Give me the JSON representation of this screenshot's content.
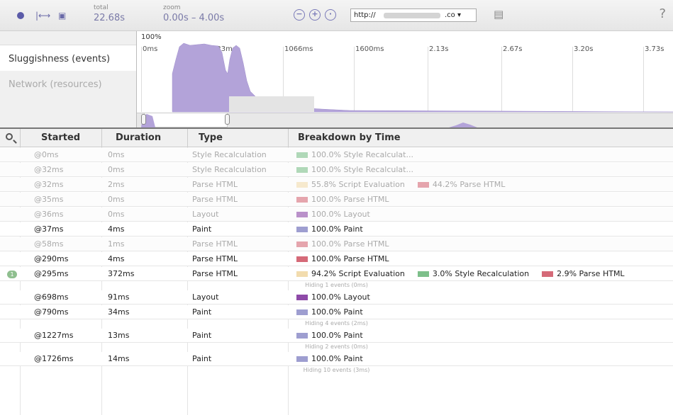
{
  "toolbar": {
    "total_label": "total",
    "total_value": "22.68s",
    "zoom_label": "zoom",
    "zoom_value": "0.00s – 4.00s",
    "url_prefix": "http://",
    "url_suffix": ".co ▾",
    "help": "?"
  },
  "sidebar": {
    "items": [
      {
        "label": "Sluggishness (events)"
      },
      {
        "label": "Network (resources)"
      }
    ]
  },
  "overview": {
    "percent_label": "100%",
    "ticks": [
      "0ms",
      "533ms",
      "1066ms",
      "1600ms",
      "2.13s",
      "2.67s",
      "3.20s",
      "3.73s"
    ]
  },
  "table": {
    "headers": [
      "Started",
      "Duration",
      "Type",
      "Breakdown by Time"
    ],
    "rows": [
      {
        "started": "@0ms",
        "duration": "0ms",
        "type": "Style Recalculation",
        "dim": true,
        "breakdown": [
          {
            "pct": "100.0% Style Recalculat...",
            "color": "#7dbf8a"
          }
        ]
      },
      {
        "started": "@32ms",
        "duration": "0ms",
        "type": "Style Recalculation",
        "dim": true,
        "breakdown": [
          {
            "pct": "100.0% Style Recalculat...",
            "color": "#7dbf8a"
          }
        ]
      },
      {
        "started": "@32ms",
        "duration": "2ms",
        "type": "Parse HTML",
        "dim": true,
        "breakdown": [
          {
            "pct": "55.8% Script Evaluation",
            "color": "#f2dcae"
          },
          {
            "pct": "44.2% Parse HTML",
            "color": "#d56a78"
          }
        ]
      },
      {
        "started": "@35ms",
        "duration": "0ms",
        "type": "Parse HTML",
        "dim": true,
        "breakdown": [
          {
            "pct": "100.0% Parse HTML",
            "color": "#d56a78"
          }
        ]
      },
      {
        "started": "@36ms",
        "duration": "0ms",
        "type": "Layout",
        "dim": true,
        "breakdown": [
          {
            "pct": "100.0% Layout",
            "color": "#8e4aa8"
          }
        ]
      },
      {
        "started": "@37ms",
        "duration": "4ms",
        "type": "Paint",
        "dim": false,
        "breakdown": [
          {
            "pct": "100.0% Paint",
            "color": "#9e9ed0"
          }
        ]
      },
      {
        "started": "@58ms",
        "duration": "1ms",
        "type": "Parse HTML",
        "dim": true,
        "breakdown": [
          {
            "pct": "100.0% Parse HTML",
            "color": "#d56a78"
          }
        ]
      },
      {
        "started": "@290ms",
        "duration": "4ms",
        "type": "Parse HTML",
        "dim": false,
        "breakdown": [
          {
            "pct": "100.0% Parse HTML",
            "color": "#d56a78"
          }
        ]
      },
      {
        "started": "@295ms",
        "duration": "372ms",
        "type": "Parse HTML",
        "dim": false,
        "badge": "1",
        "breakdown": [
          {
            "pct": "94.2% Script Evaluation",
            "color": "#f2dcae"
          },
          {
            "pct": "3.0% Style Recalculation",
            "color": "#7dbf8a"
          },
          {
            "pct": "2.9% Parse HTML",
            "color": "#d56a78"
          }
        ],
        "hiding": "Hiding 1 events (0ms)"
      },
      {
        "started": "@698ms",
        "duration": "91ms",
        "type": "Layout",
        "dim": false,
        "breakdown": [
          {
            "pct": "100.0% Layout",
            "color": "#8e4aa8"
          }
        ]
      },
      {
        "started": "@790ms",
        "duration": "34ms",
        "type": "Paint",
        "dim": false,
        "breakdown": [
          {
            "pct": "100.0% Paint",
            "color": "#9e9ed0"
          }
        ],
        "hiding": "Hiding 4 events (2ms)"
      },
      {
        "started": "@1227ms",
        "duration": "13ms",
        "type": "Paint",
        "dim": false,
        "breakdown": [
          {
            "pct": "100.0% Paint",
            "color": "#9e9ed0"
          }
        ],
        "hiding": "Hiding 2 events (0ms)"
      },
      {
        "started": "@1726ms",
        "duration": "14ms",
        "type": "Paint",
        "dim": false,
        "breakdown": [
          {
            "pct": "100.0% Paint",
            "color": "#9e9ed0"
          }
        ],
        "hiding": "Hiding 10 events (3ms)"
      }
    ]
  },
  "colors": {
    "accent": "#6a6aa8",
    "overview_fill": "#b3a3d9"
  }
}
